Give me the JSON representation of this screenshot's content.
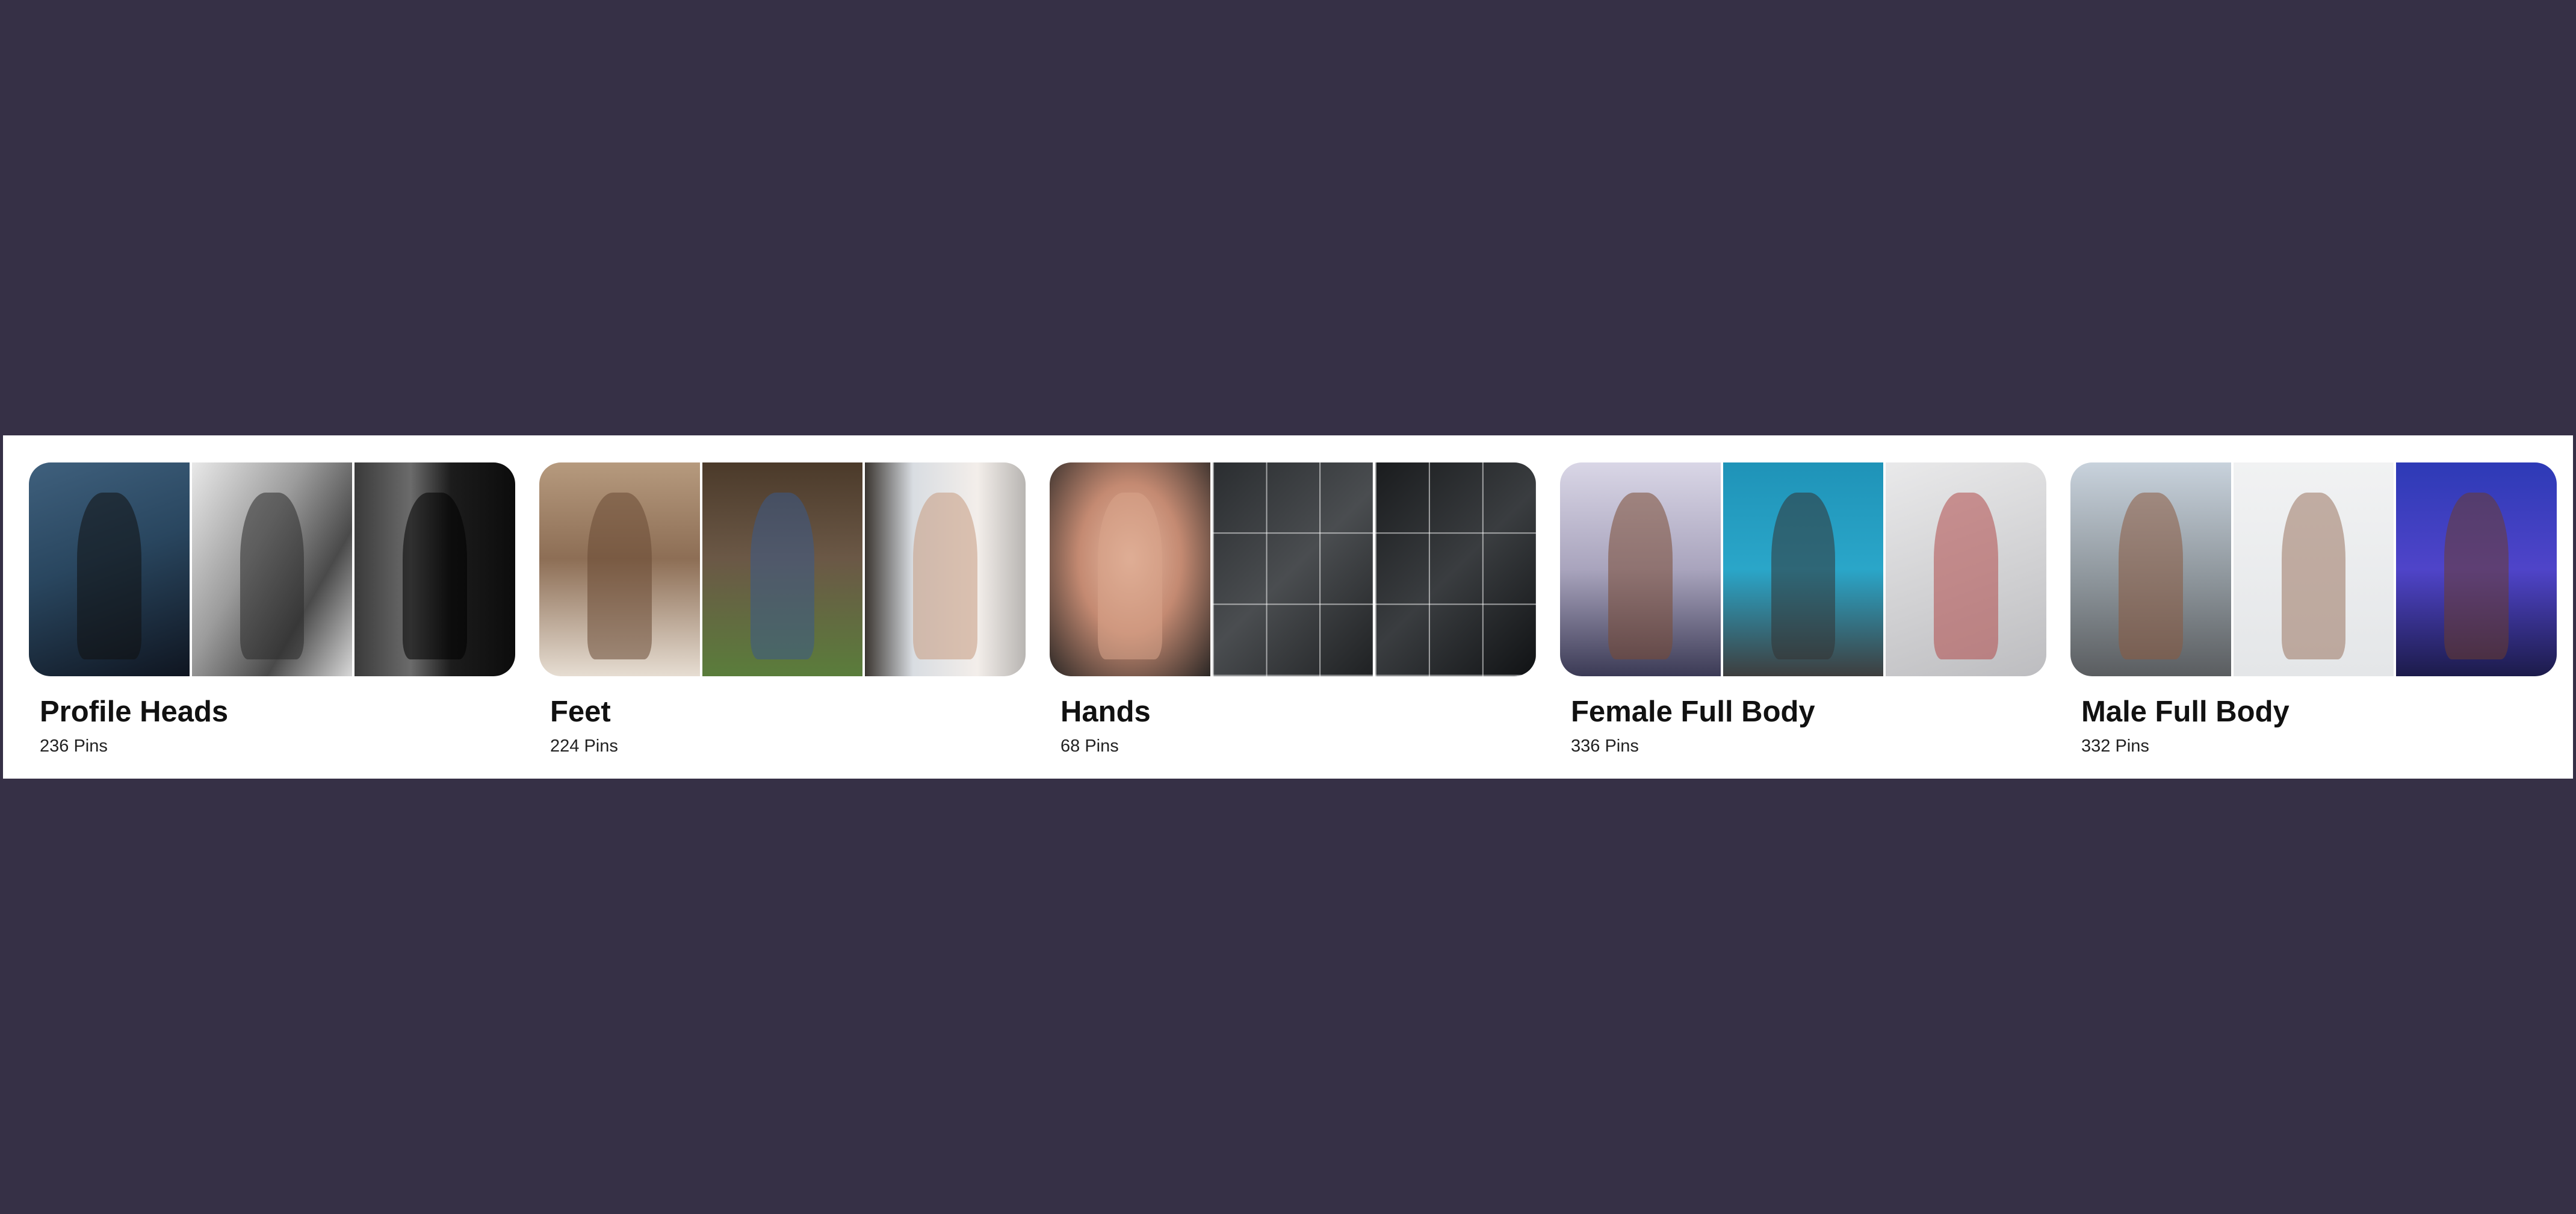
{
  "boards": [
    {
      "title": "Profile Heads",
      "pins": "236 Pins",
      "images": [
        "bearded-man-coat-photo",
        "elderly-woman-profile-photo",
        "couple-kissing-bw-photo"
      ]
    },
    {
      "title": "Feet",
      "pins": "224 Pins",
      "images": [
        "dancers-at-barre-photo",
        "woman-sitting-grass-photo",
        "woman-at-balcony-photo"
      ]
    },
    {
      "title": "Hands",
      "pins": "68 Pins",
      "images": [
        "hands-over-face-photo",
        "hand-poses-grid-photo",
        "hand-gestures-grid-photo"
      ]
    },
    {
      "title": "Female Full Body",
      "pins": "336 Pins",
      "images": [
        "fitness-model-pose-photo",
        "high-kick-lockers-photo",
        "backbend-pose-photo"
      ]
    },
    {
      "title": "Male Full Body",
      "pins": "332 Pins",
      "images": [
        "shirtless-man-flexing-photo",
        "male-dancer-leap-photo",
        "ballet-couple-stage-photo"
      ]
    }
  ],
  "colors": {
    "background": "#363046",
    "strip": "#ffffff",
    "title_text": "#111111"
  }
}
